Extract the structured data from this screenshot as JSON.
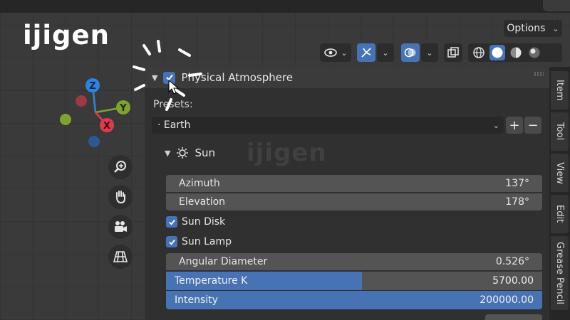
{
  "brand": {
    "logo_text": "ijigen"
  },
  "header": {
    "options_label": "Options",
    "icons": [
      "visibility-icon",
      "gizmo-icon",
      "overlay-icon",
      "xray-icon"
    ],
    "shading_modes": [
      "wireframe",
      "solid",
      "material",
      "rendered"
    ],
    "active_shading": "solid"
  },
  "navigation": {
    "gizmo_axes": {
      "x": "X",
      "y": "Y",
      "z": "Z"
    },
    "tools": [
      "zoom-icon",
      "hand-pan-icon",
      "camera-icon",
      "grid-perspective-icon"
    ]
  },
  "panel": {
    "title": "Physical Atmosphere",
    "enabled": true,
    "presets_label": "Presets:",
    "preset_value": "Earth",
    "sun_section": "Sun",
    "azimuth": {
      "label": "Azimuth",
      "value": "137°"
    },
    "elevation": {
      "label": "Elevation",
      "value": "178°"
    },
    "sun_disk": {
      "label": "Sun Disk",
      "checked": true
    },
    "sun_lamp": {
      "label": "Sun Lamp",
      "checked": true
    },
    "angular_diameter": {
      "label": "Angular Diameter",
      "value": "0.526°"
    },
    "temperature": {
      "label": "Temperature K",
      "value": "5700.00",
      "fill": 0.52
    },
    "intensity": {
      "label": "Intensity",
      "value": "200000.00",
      "fill": 1.0
    }
  },
  "tabs": [
    "Item",
    "Tool",
    "View",
    "Edit",
    "Grease Pencil"
  ],
  "colors": {
    "accent": "#4772b3",
    "axis_x": "#e03a4f",
    "axis_y": "#7ea330",
    "axis_z": "#2f83de"
  }
}
